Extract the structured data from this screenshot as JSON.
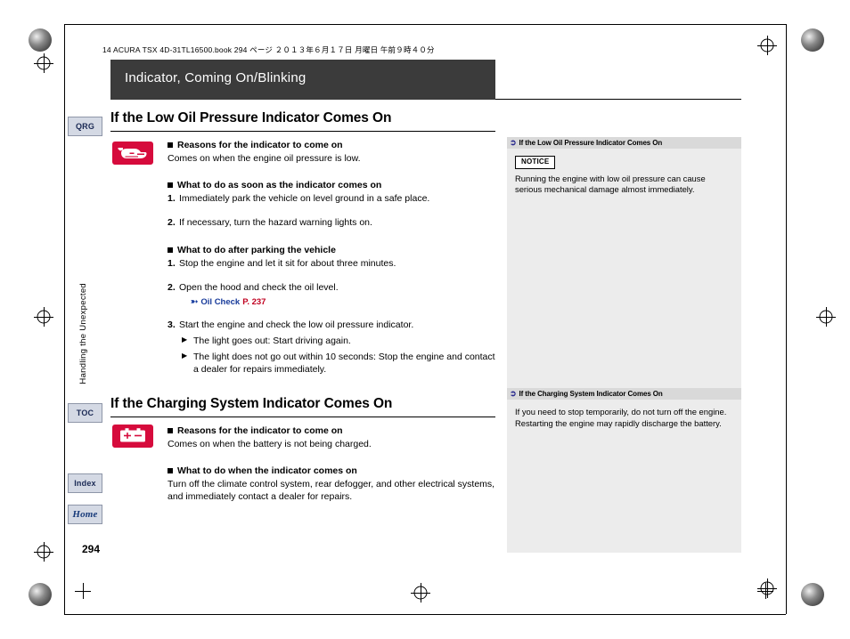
{
  "page": {
    "file_header": "14 ACURA TSX 4D-31TL16500.book   294 ページ   ２０１３年６月１７日   月曜日   午前９時４０分",
    "chapter_title": "Indicator, Coming On/Blinking",
    "side_label": "Handling the Unexpected",
    "page_number": "294"
  },
  "tabs": [
    {
      "id": "qrg",
      "label": "QRG"
    },
    {
      "id": "toc",
      "label": "TOC"
    },
    {
      "id": "index",
      "label": "Index"
    },
    {
      "id": "home",
      "label": "Home"
    }
  ],
  "sections": [
    {
      "title": "If the Low Oil Pressure Indicator Comes On",
      "icon": "oil-pressure-indicator-icon",
      "blocks": [
        {
          "type": "heading",
          "text": "Reasons for the indicator to come on"
        },
        {
          "type": "paragraph",
          "text": "Comes on when the engine oil pressure is low."
        },
        {
          "type": "heading",
          "text": "What to do as soon as the indicator comes on"
        },
        {
          "type": "numbered",
          "num": "1.",
          "text": "Immediately park the vehicle on level ground in a safe place."
        },
        {
          "type": "numbered",
          "num": "2.",
          "text": "If necessary, turn the hazard warning lights on."
        },
        {
          "type": "heading",
          "text": "What to do after parking the vehicle"
        },
        {
          "type": "numbered",
          "num": "1.",
          "text": "Stop the engine and let it sit for about three minutes."
        },
        {
          "type": "numbered",
          "num": "2.",
          "text": "Open the hood and check the oil level."
        },
        {
          "type": "reference",
          "title": "Oil Check",
          "page": "P. 237"
        },
        {
          "type": "numbered",
          "num": "3.",
          "text": "Start the engine and check the low oil pressure indicator."
        },
        {
          "type": "arrow",
          "text": "The light goes out: Start driving again."
        },
        {
          "type": "arrow",
          "text": "The light does not go out within 10 seconds: Stop the engine and contact a dealer for repairs immediately."
        }
      ]
    },
    {
      "title": "If the Charging System Indicator Comes On",
      "icon": "battery-charging-indicator-icon",
      "blocks": [
        {
          "type": "heading",
          "text": "Reasons for the indicator to come on"
        },
        {
          "type": "paragraph",
          "text": "Comes on when the battery is not being charged."
        },
        {
          "type": "heading",
          "text": "What to do when the indicator comes on"
        },
        {
          "type": "paragraph",
          "text": "Turn off the climate control system, rear defogger, and other electrical systems, and immediately contact a dealer for repairs."
        }
      ]
    }
  ],
  "sidenotes": [
    {
      "header": "If the Low Oil Pressure Indicator Comes On",
      "badge": "NOTICE",
      "text": "Running the engine with low oil pressure can cause serious mechanical damage almost immediately."
    },
    {
      "header": "If the Charging System Indicator Comes On",
      "badge": "",
      "text": "If you need to stop temporarily, do not turn off the engine. Restarting the engine may rapidly discharge the battery."
    }
  ]
}
